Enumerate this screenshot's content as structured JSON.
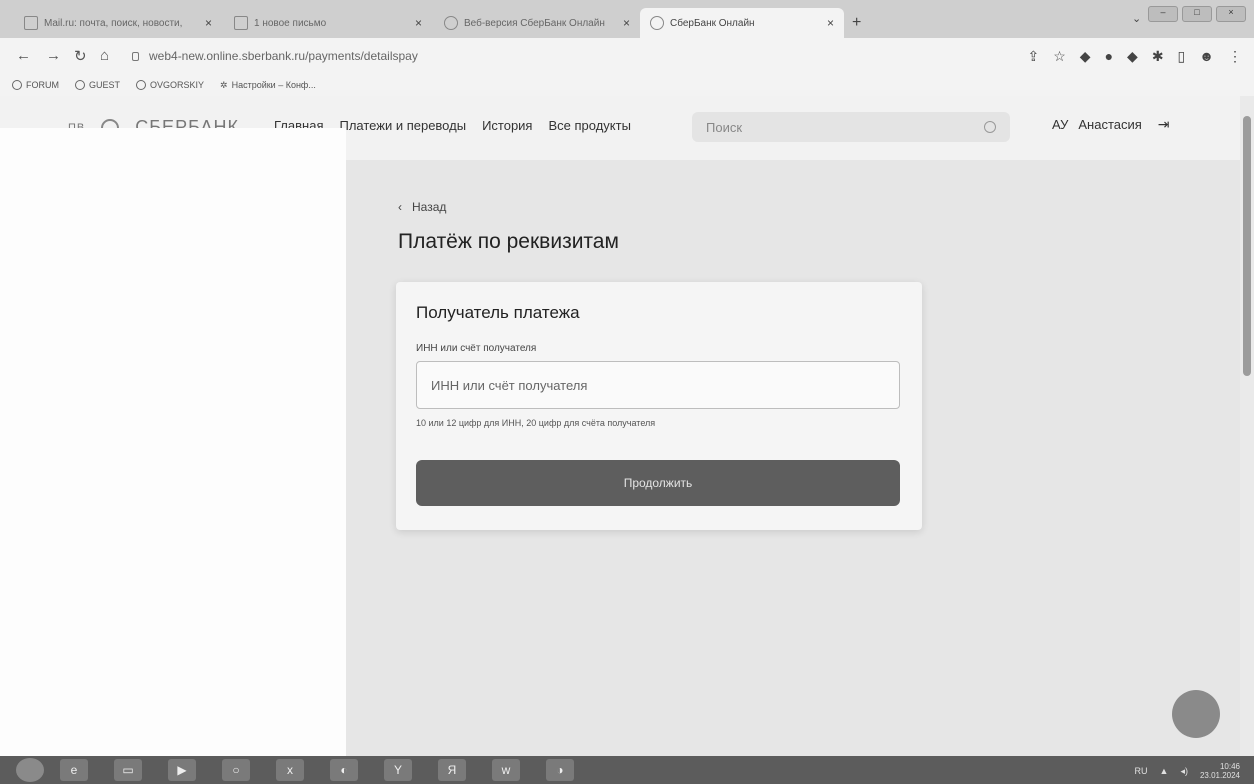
{
  "browser": {
    "tabs": [
      {
        "label": "Mail.ru: почта, поиск, новости,",
        "active": false
      },
      {
        "label": "1 новое письмо",
        "active": false
      },
      {
        "label": "Веб-версия СберБанк Онлайн",
        "active": false
      },
      {
        "label": "СберБанк Онлайн",
        "active": true
      }
    ],
    "new_tab": "+",
    "url": "web4-new.online.sberbank.ru/payments/detailspay",
    "bookmarks": [
      "FORUM",
      "GUEST",
      "OVGORSKIY",
      "Настройки – Конф..."
    ]
  },
  "header": {
    "logo_text": "СБЕРБАНК",
    "nav": [
      "Главная",
      "Платежи и переводы",
      "История",
      "Все продукты"
    ],
    "search_placeholder": "Поиск",
    "user_initials": "АУ",
    "user_name": "Анастасия"
  },
  "page": {
    "back_label": "Назад",
    "title": "Платёж по реквизитам",
    "card": {
      "title": "Получатель платежа",
      "field_label": "ИНН или счёт получателя",
      "field_placeholder": "ИНН или счёт получателя",
      "hint": "10 или 12 цифр для ИНН, 20 цифр для счёта получателя",
      "submit_label": "Продолжить"
    }
  },
  "taskbar": {
    "lang": "RU",
    "time": "10:46",
    "date": "23.01.2024"
  }
}
